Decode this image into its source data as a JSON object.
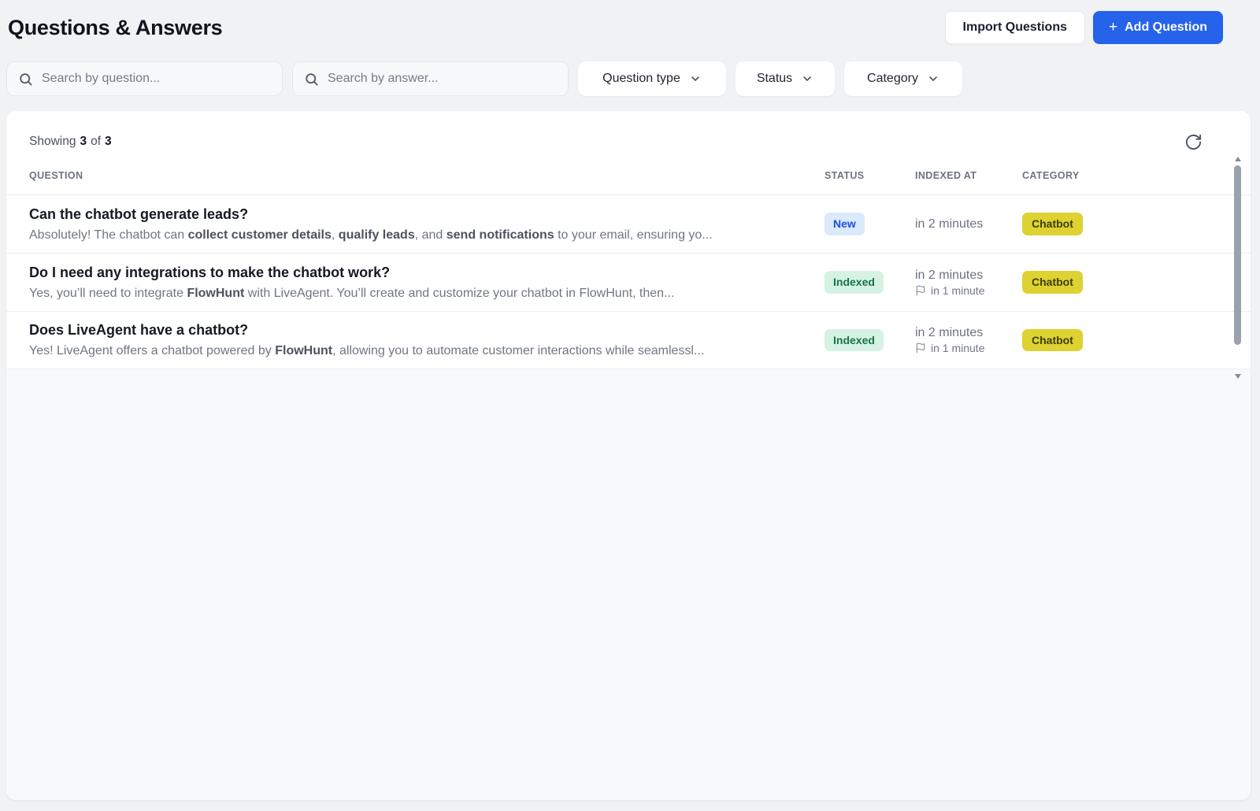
{
  "page": {
    "title": "Questions & Answers"
  },
  "header": {
    "import_button": "Import Questions",
    "add_button": "Add Question",
    "add_button_plus": "+"
  },
  "filters": {
    "search_question_placeholder": "Search by question...",
    "search_answer_placeholder": "Search by answer...",
    "dropdowns": [
      {
        "label": "Question type"
      },
      {
        "label": "Status"
      },
      {
        "label": "Category"
      }
    ]
  },
  "table": {
    "showing": {
      "label": "Showing",
      "count": "3",
      "of": "of",
      "total": "3"
    },
    "columns": [
      "QUESTION",
      "STATUS",
      "INDEXED AT",
      "CATEGORY"
    ],
    "rows": [
      {
        "question": "Can the chatbot generate leads?",
        "answer_parts": [
          {
            "text": "Absolutely! The chatbot can ",
            "bold": false
          },
          {
            "text": "collect customer details",
            "bold": true
          },
          {
            "text": ", ",
            "bold": false
          },
          {
            "text": "qualify leads",
            "bold": true
          },
          {
            "text": ", and ",
            "bold": false
          },
          {
            "text": "send notifications",
            "bold": true
          },
          {
            "text": " to your email, ensuring yo...",
            "bold": false
          }
        ],
        "status": {
          "label": "New",
          "variant": "new"
        },
        "indexed_at": "in 2 minutes",
        "indexed_secondary": null,
        "category": "Chatbot"
      },
      {
        "question": "Do I need any integrations to make the chatbot work?",
        "answer_parts": [
          {
            "text": "Yes, you’ll need to integrate ",
            "bold": false
          },
          {
            "text": "FlowHunt",
            "bold": true
          },
          {
            "text": " with LiveAgent. You’ll create and customize your chatbot in FlowHunt, then...",
            "bold": false
          }
        ],
        "status": {
          "label": "Indexed",
          "variant": "indexed"
        },
        "indexed_at": "in 2 minutes",
        "indexed_secondary": "in 1 minute",
        "category": "Chatbot"
      },
      {
        "question": "Does LiveAgent have a chatbot?",
        "answer_parts": [
          {
            "text": "Yes! LiveAgent offers a chatbot powered by ",
            "bold": false
          },
          {
            "text": "FlowHunt",
            "bold": true
          },
          {
            "text": ", allowing you to automate customer interactions while seamlessl...",
            "bold": false
          }
        ],
        "status": {
          "label": "Indexed",
          "variant": "indexed"
        },
        "indexed_at": "in 2 minutes",
        "indexed_secondary": "in 1 minute",
        "category": "Chatbot"
      }
    ]
  },
  "icons": {
    "search": "search-icon",
    "chevron": "chevron-down-icon",
    "refresh": "refresh-icon",
    "flag": "flag-icon",
    "plus": "plus-icon"
  },
  "colors": {
    "accent_blue": "#2563eb",
    "badge_new_bg": "#dbe9fd",
    "badge_new_text": "#1d4fd7",
    "badge_indexed_bg": "#d6f2e3",
    "badge_indexed_text": "#157347",
    "badge_category_bg": "#ddd231",
    "badge_category_text": "#3f3e0c",
    "page_bg": "#f1f2f4"
  }
}
